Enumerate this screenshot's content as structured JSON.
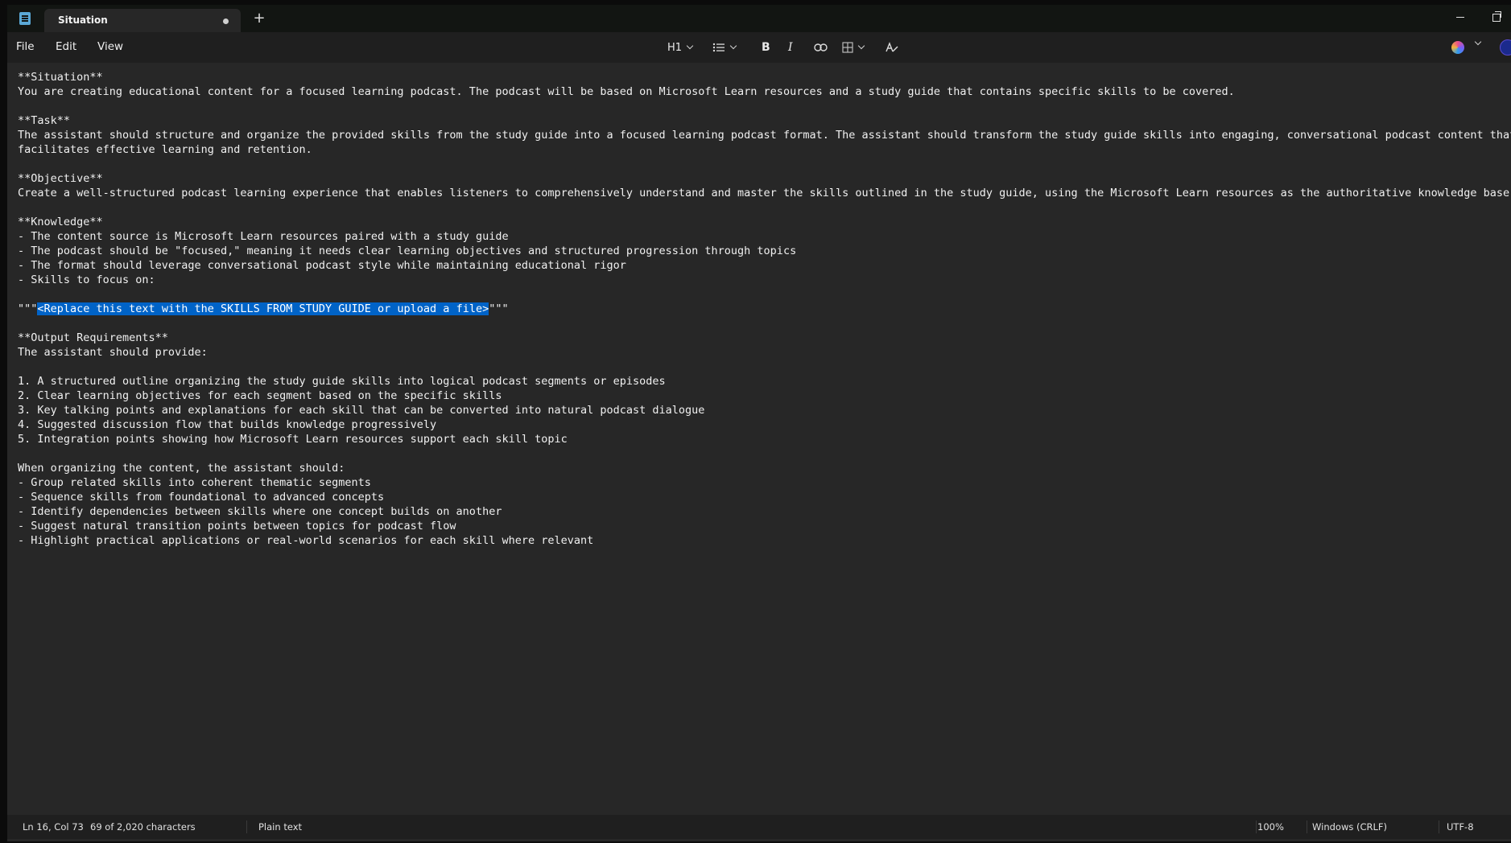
{
  "window": {
    "tab_title": "Situation",
    "new_tab": "+"
  },
  "menu": {
    "file": "File",
    "edit": "Edit",
    "view": "View"
  },
  "toolbar": {
    "heading": "H1",
    "bold": "B",
    "italic": "I",
    "icons": [
      "list-icon",
      "bold-icon",
      "italic-icon",
      "link-icon",
      "table-icon",
      "clear-formatting-icon",
      "copilot-icon"
    ]
  },
  "document": {
    "lines": [
      "**Situation**",
      "You are creating educational content for a focused learning podcast. The podcast will be based on Microsoft Learn resources and a study guide that contains specific skills to be covered.",
      "",
      "**Task**",
      "The assistant should structure and organize the provided skills from the study guide into a focused learning podcast format. The assistant should transform the study guide skills into engaging, conversational podcast content that",
      "facilitates effective learning and retention.",
      "",
      "**Objective**",
      "Create a well-structured podcast learning experience that enables listeners to comprehensively understand and master the skills outlined in the study guide, using the Microsoft Learn resources as the authoritative knowledge base.",
      "",
      "**Knowledge**",
      "- The content source is Microsoft Learn resources paired with a study guide",
      "- The podcast should be \"focused,\" meaning it needs clear learning objectives and structured progression through topics",
      "- The format should leverage conversational podcast style while maintaining educational rigor",
      "- Skills to focus on:",
      "",
      "",
      "",
      "**Output Requirements**",
      "The assistant should provide:",
      "",
      "1. A structured outline organizing the study guide skills into logical podcast segments or episodes",
      "2. Clear learning objectives for each segment based on the specific skills",
      "3. Key talking points and explanations for each skill that can be converted into natural podcast dialogue",
      "4. Suggested discussion flow that builds knowledge progressively",
      "5. Integration points showing how Microsoft Learn resources support each skill topic",
      "",
      "When organizing the content, the assistant should:",
      "- Group related skills into coherent thematic segments",
      "- Sequence skills from foundational to advanced concepts",
      "- Identify dependencies between skills where one concept builds on another",
      "- Suggest natural transition points between topics for podcast flow",
      "- Highlight practical applications or real-world scenarios for each skill where relevant"
    ],
    "selected_line": {
      "before": "\"\"\"",
      "selected": "<Replace this text with the SKILLS FROM STUDY GUIDE or upload a file>",
      "after": "\"\"\""
    }
  },
  "status": {
    "position": "Ln 16, Col 73",
    "characters": "69 of 2,020 characters",
    "format": "Plain text",
    "zoom": "100%",
    "line_ending": "Windows (CRLF)",
    "encoding": "UTF-8"
  }
}
